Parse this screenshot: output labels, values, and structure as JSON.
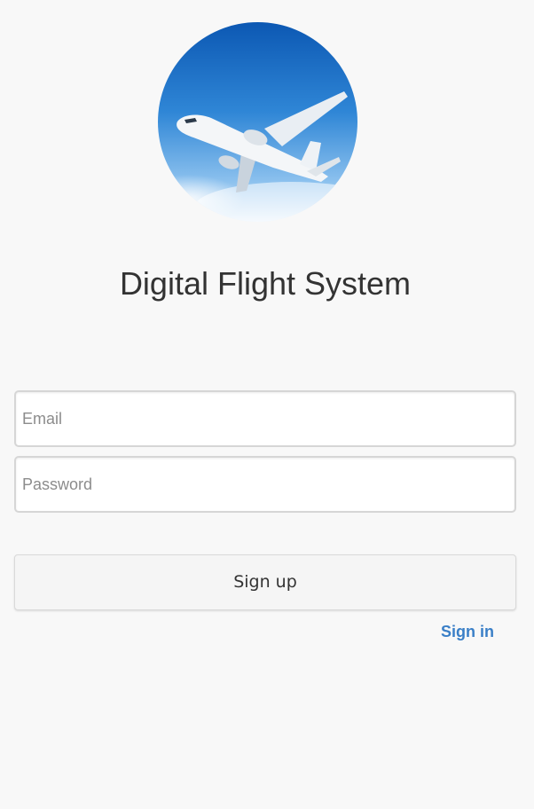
{
  "logo": {
    "icon": "airplane-icon"
  },
  "title": "Digital Flight System",
  "form": {
    "email_placeholder": "Email",
    "password_placeholder": "Password",
    "signup_label": "Sign up",
    "signin_label": "Sign in"
  },
  "colors": {
    "background": "#f8f8f8",
    "link": "#3a7fc7",
    "sky": "#1e73c9"
  }
}
